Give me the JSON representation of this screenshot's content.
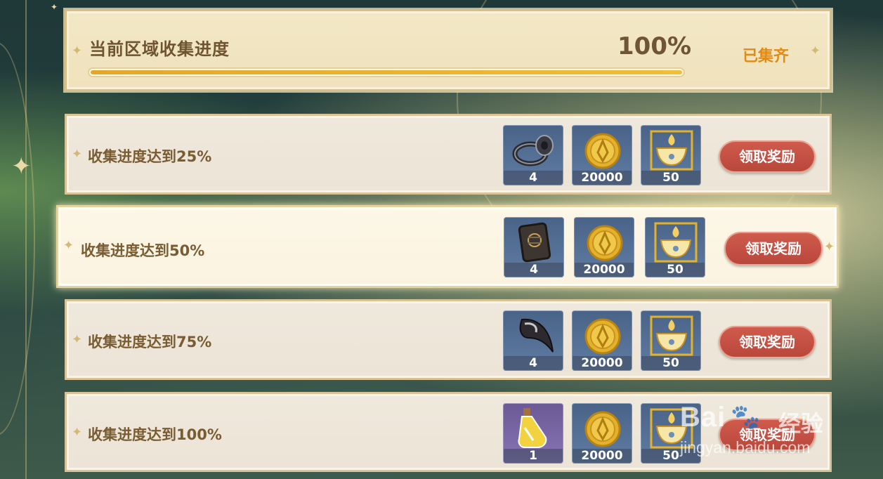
{
  "header": {
    "title": "当前区域收集进度",
    "percent_text": "100%",
    "progress_fraction": 1.0,
    "status": "已集齐"
  },
  "rewards": [
    {
      "label": "收集进度达到25%",
      "items": [
        {
          "icon": "bracelet-icon",
          "count": "4"
        },
        {
          "icon": "mora-coin-icon",
          "count": "20000"
        },
        {
          "icon": "pot-icon",
          "count": "50"
        }
      ],
      "button": "领取奖励"
    },
    {
      "label": "收集进度达到50%",
      "items": [
        {
          "icon": "emblem-tablet-icon",
          "count": "4"
        },
        {
          "icon": "mora-coin-icon",
          "count": "20000"
        },
        {
          "icon": "pot-icon",
          "count": "50"
        }
      ],
      "button": "领取奖励"
    },
    {
      "label": "收集进度达到75%",
      "items": [
        {
          "icon": "horn-icon",
          "count": "4"
        },
        {
          "icon": "mora-coin-icon",
          "count": "20000"
        },
        {
          "icon": "pot-icon",
          "count": "50"
        }
      ],
      "button": "领取奖励"
    },
    {
      "label": "收集进度达到100%",
      "items": [
        {
          "icon": "potion-bottle-icon",
          "count": "1"
        },
        {
          "icon": "mora-coin-icon",
          "count": "20000"
        },
        {
          "icon": "pot-icon",
          "count": "50"
        }
      ],
      "button": "领取奖励"
    }
  ],
  "watermark": {
    "brand": "Bai",
    "brand_cn": "经验",
    "url": "jingyan.baidu.com"
  },
  "colors": {
    "accent_orange": "#e28a14",
    "button_red": "#c4513f",
    "label_brown": "#7a5c33",
    "progress_gold": "#e9b432"
  }
}
